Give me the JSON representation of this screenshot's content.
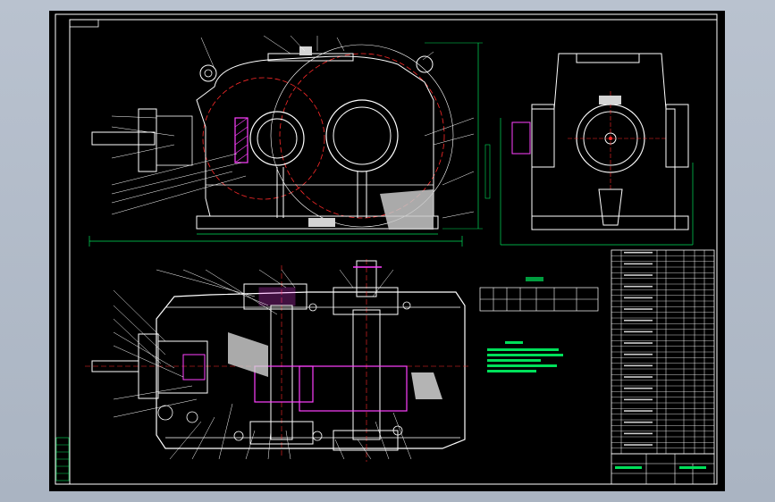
{
  "app": {
    "background": "#b9c2cf",
    "canvas_bg": "#000000"
  },
  "colors": {
    "outline": "#ffffff",
    "dim": "#00e05a",
    "center": "#ff2a2a",
    "hatch": "#ff40ff",
    "solid": "#d4d4d4",
    "leader": "#ffffff"
  },
  "drawing": {
    "title_block_label": "",
    "tech_note_heading": "",
    "table_heading": ""
  }
}
